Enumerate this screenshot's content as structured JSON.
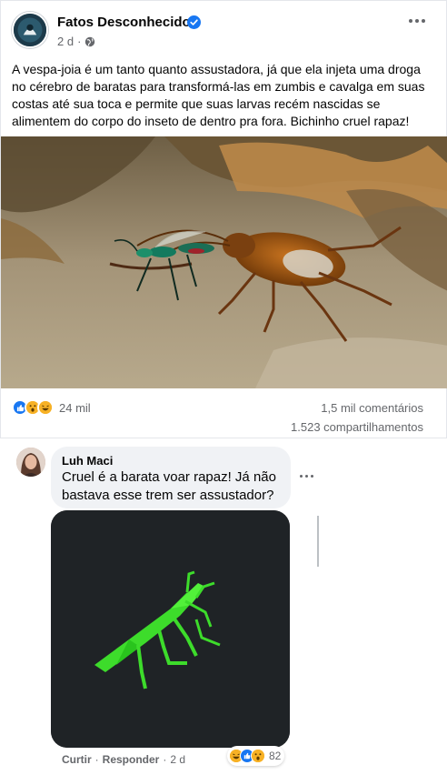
{
  "post": {
    "page_name": "Fatos Desconhecidos",
    "time": "2 d",
    "meta_separator": "·",
    "text": "A vespa-joia é um tanto quanto assustadora, já que ela injeta uma droga no cérebro de baratas para transformá-las em zumbis e cavalga em suas costas até sua toca e permite que suas larvas recém nascidas se alimentem do corpo do inseto de dentro pra fora. Bichinho cruel rapaz!",
    "reactions": [
      "like",
      "wow",
      "haha"
    ],
    "reaction_count": "24 mil",
    "comments_count": "1,5 mil comentários",
    "shares_count": "1.523 compartilhamentos"
  },
  "comment": {
    "author": "Luh Maci",
    "text": "Cruel é a barata voar rapaz! Já não bastava esse trem ser assustador?",
    "like_label": "Curtir",
    "reply_label": "Responder",
    "separator": "·",
    "time": "2 d",
    "reactions": [
      "haha",
      "like",
      "wow"
    ],
    "reaction_count": "82"
  },
  "colors": {
    "accent": "#1877f2",
    "secondary_text": "#65676b",
    "bubble": "#f0f2f5",
    "gif_background": "#1f2326",
    "gif_insect": "#3ddc2b"
  },
  "icons": {
    "verified": "verified-badge-icon",
    "globe": "globe-icon",
    "more": "more-options-icon"
  }
}
